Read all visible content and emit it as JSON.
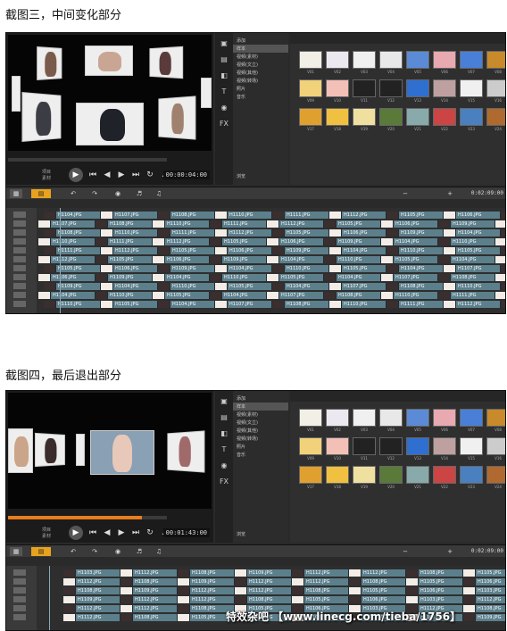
{
  "caption1": "截图三，中间变化部分",
  "caption2": "截图四，最后退出部分",
  "shot1": {
    "timecode": "00:00:04:00",
    "player_label": "项目\n素材",
    "timeline_timecode": "0:02:09:00",
    "clip_names": [
      "H1104.JPG",
      "H1107.JPG",
      "H1108.JPG",
      "H1110.JPG",
      "H1111.JPG",
      "H1112.JPG",
      "H1105.JPG",
      "H1106.JPG",
      "H1109.JPG",
      "H1104.JPG",
      "H1110.JPG",
      "H1105.JPG"
    ]
  },
  "shot2": {
    "timecode": "00:01:43:00",
    "player_label": "项目\n素材",
    "timeline_timecode": "0:02:09:00",
    "clip_names": [
      "H1103.JPG",
      "H1112.JPG",
      "H1108.JPG",
      "H1109.JPG",
      "H1112.JPG",
      "H1112.JPG",
      "H1108.JPG",
      "H1105.JPG",
      "H1106.JPG"
    ]
  },
  "library": {
    "add_label": "添加",
    "items": [
      "样本",
      "视频(素材)",
      "视频(文立)",
      "视频(其他)",
      "视频(转场)",
      "照片",
      "音乐"
    ],
    "browse_label": "浏览"
  },
  "thumb_labels": [
    "V01",
    "V02",
    "V03",
    "V04",
    "V05",
    "V06",
    "V07",
    "V08",
    "V09",
    "V10",
    "V11",
    "V12",
    "V13",
    "V14",
    "V15",
    "V16",
    "V17",
    "V18",
    "V19",
    "V20",
    "V21",
    "V22",
    "V23",
    "V24"
  ],
  "watermark": "特效杂吧 【www.linecg.com/tieba/1756】",
  "icons": {
    "play": "play-icon",
    "rewind": "rewind-icon",
    "undo": "undo-icon",
    "redo": "redo-icon",
    "zoom_in": "zoom-in-icon",
    "zoom_out": "zoom-out-icon"
  }
}
